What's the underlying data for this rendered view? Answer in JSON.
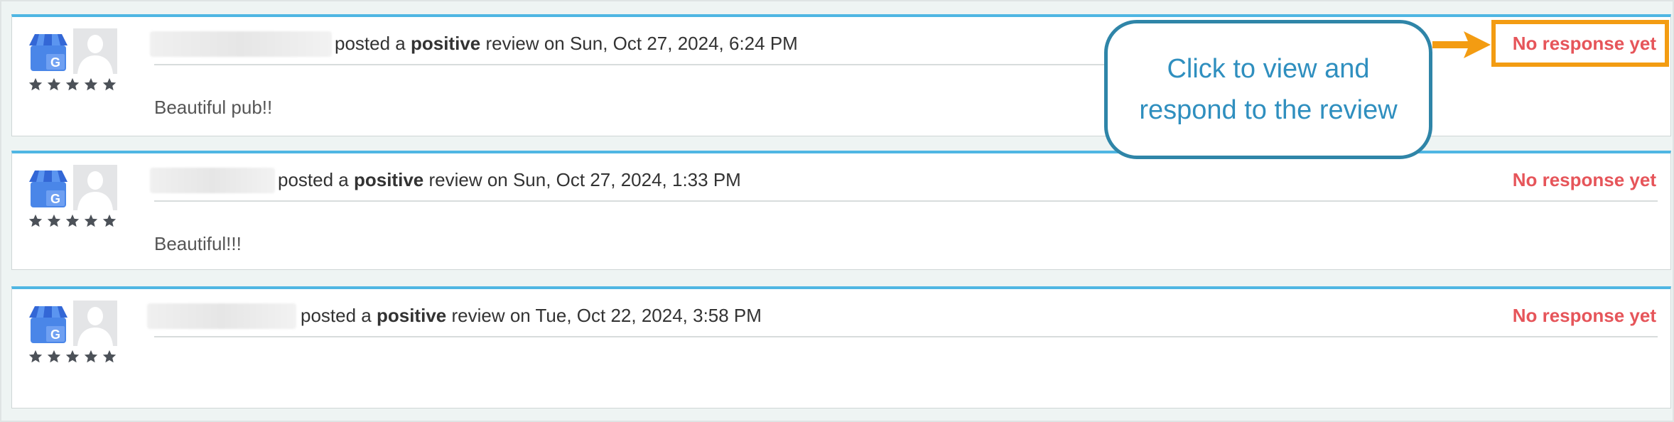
{
  "reviews": [
    {
      "posted_text": "posted a",
      "sentiment": "positive",
      "review_on": "review on Sun, Oct 27, 2024, 6:24 PM",
      "body": "Beautiful pub!!",
      "status": "No response yet",
      "rating": 5
    },
    {
      "posted_text": "posted a",
      "sentiment": "positive",
      "review_on": "review on Sun, Oct 27, 2024, 1:33 PM",
      "body": "Beautiful!!!",
      "status": "No response yet",
      "rating": 5
    },
    {
      "posted_text": "posted a",
      "sentiment": "positive",
      "review_on": "review on Tue, Oct 22, 2024, 3:58 PM",
      "body": "",
      "status": "No response yet",
      "rating": 5
    }
  ],
  "callout": {
    "line1": "Click to view and",
    "line2": "respond to the review"
  },
  "colors": {
    "accent_border": "#4fb6e3",
    "status_red": "#e6555a",
    "highlight_orange": "#f39c12",
    "callout_blue": "#2f85a8"
  },
  "icons": [
    "google-my-business-icon",
    "avatar-placeholder-icon",
    "star-icon",
    "arrow-right-icon"
  ]
}
